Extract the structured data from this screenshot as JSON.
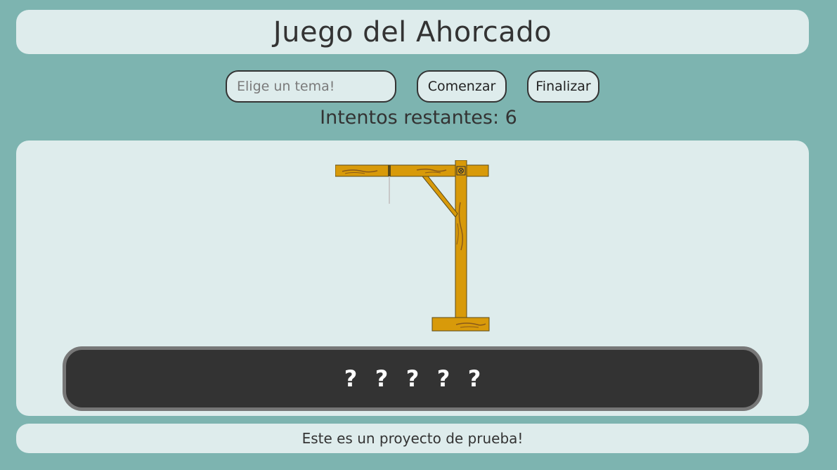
{
  "header": {
    "title": "Juego del Ahorcado"
  },
  "controls": {
    "topic_placeholder": "Elige un tema!",
    "start_label": "Comenzar",
    "end_label": "Finalizar"
  },
  "status": {
    "attempts_text": "Intentos restantes: 6"
  },
  "board": {
    "gallows": "gallows-image",
    "word": [
      "?",
      "?",
      "?",
      "?",
      "?"
    ]
  },
  "footer": {
    "text": "Este es un proyecto de prueba!"
  },
  "colors": {
    "background": "#7db4b0",
    "panel": "#deecec",
    "word_panel": "#333333",
    "wood": "#d89a0a"
  }
}
